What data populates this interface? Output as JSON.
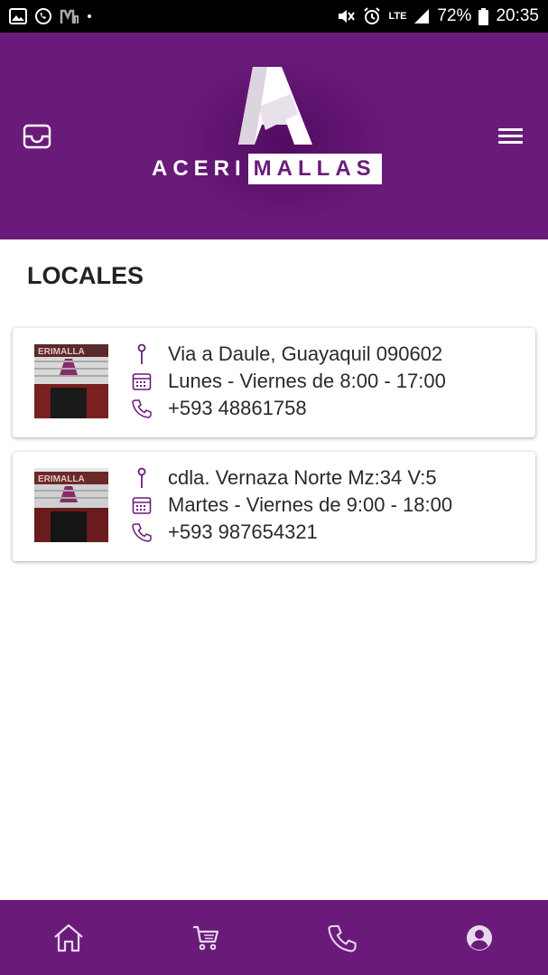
{
  "status_bar": {
    "battery": "72%",
    "time": "20:35",
    "network": "LTE"
  },
  "header": {
    "logo_part1": "ACERI",
    "logo_part2": "MALLAS"
  },
  "page": {
    "title": "LOCALES"
  },
  "stores": [
    {
      "address": "Via a Daule, Guayaquil 090602",
      "hours": "Lunes - Viernes de 8:00 - 17:00",
      "phone": "+593 48861758"
    },
    {
      "address": "cdla. Vernaza Norte Mz:34 V:5",
      "hours": "Martes - Viernes de 9:00 - 18:00",
      "phone": "+593 987654321"
    }
  ],
  "bottom_nav": {
    "items": [
      "home-icon",
      "cart-icon",
      "phone-icon",
      "account-icon"
    ]
  },
  "colors": {
    "brand": "#6a1b7a",
    "icon": "#6a1b7a",
    "nav_icon": "#e9d9ee"
  }
}
